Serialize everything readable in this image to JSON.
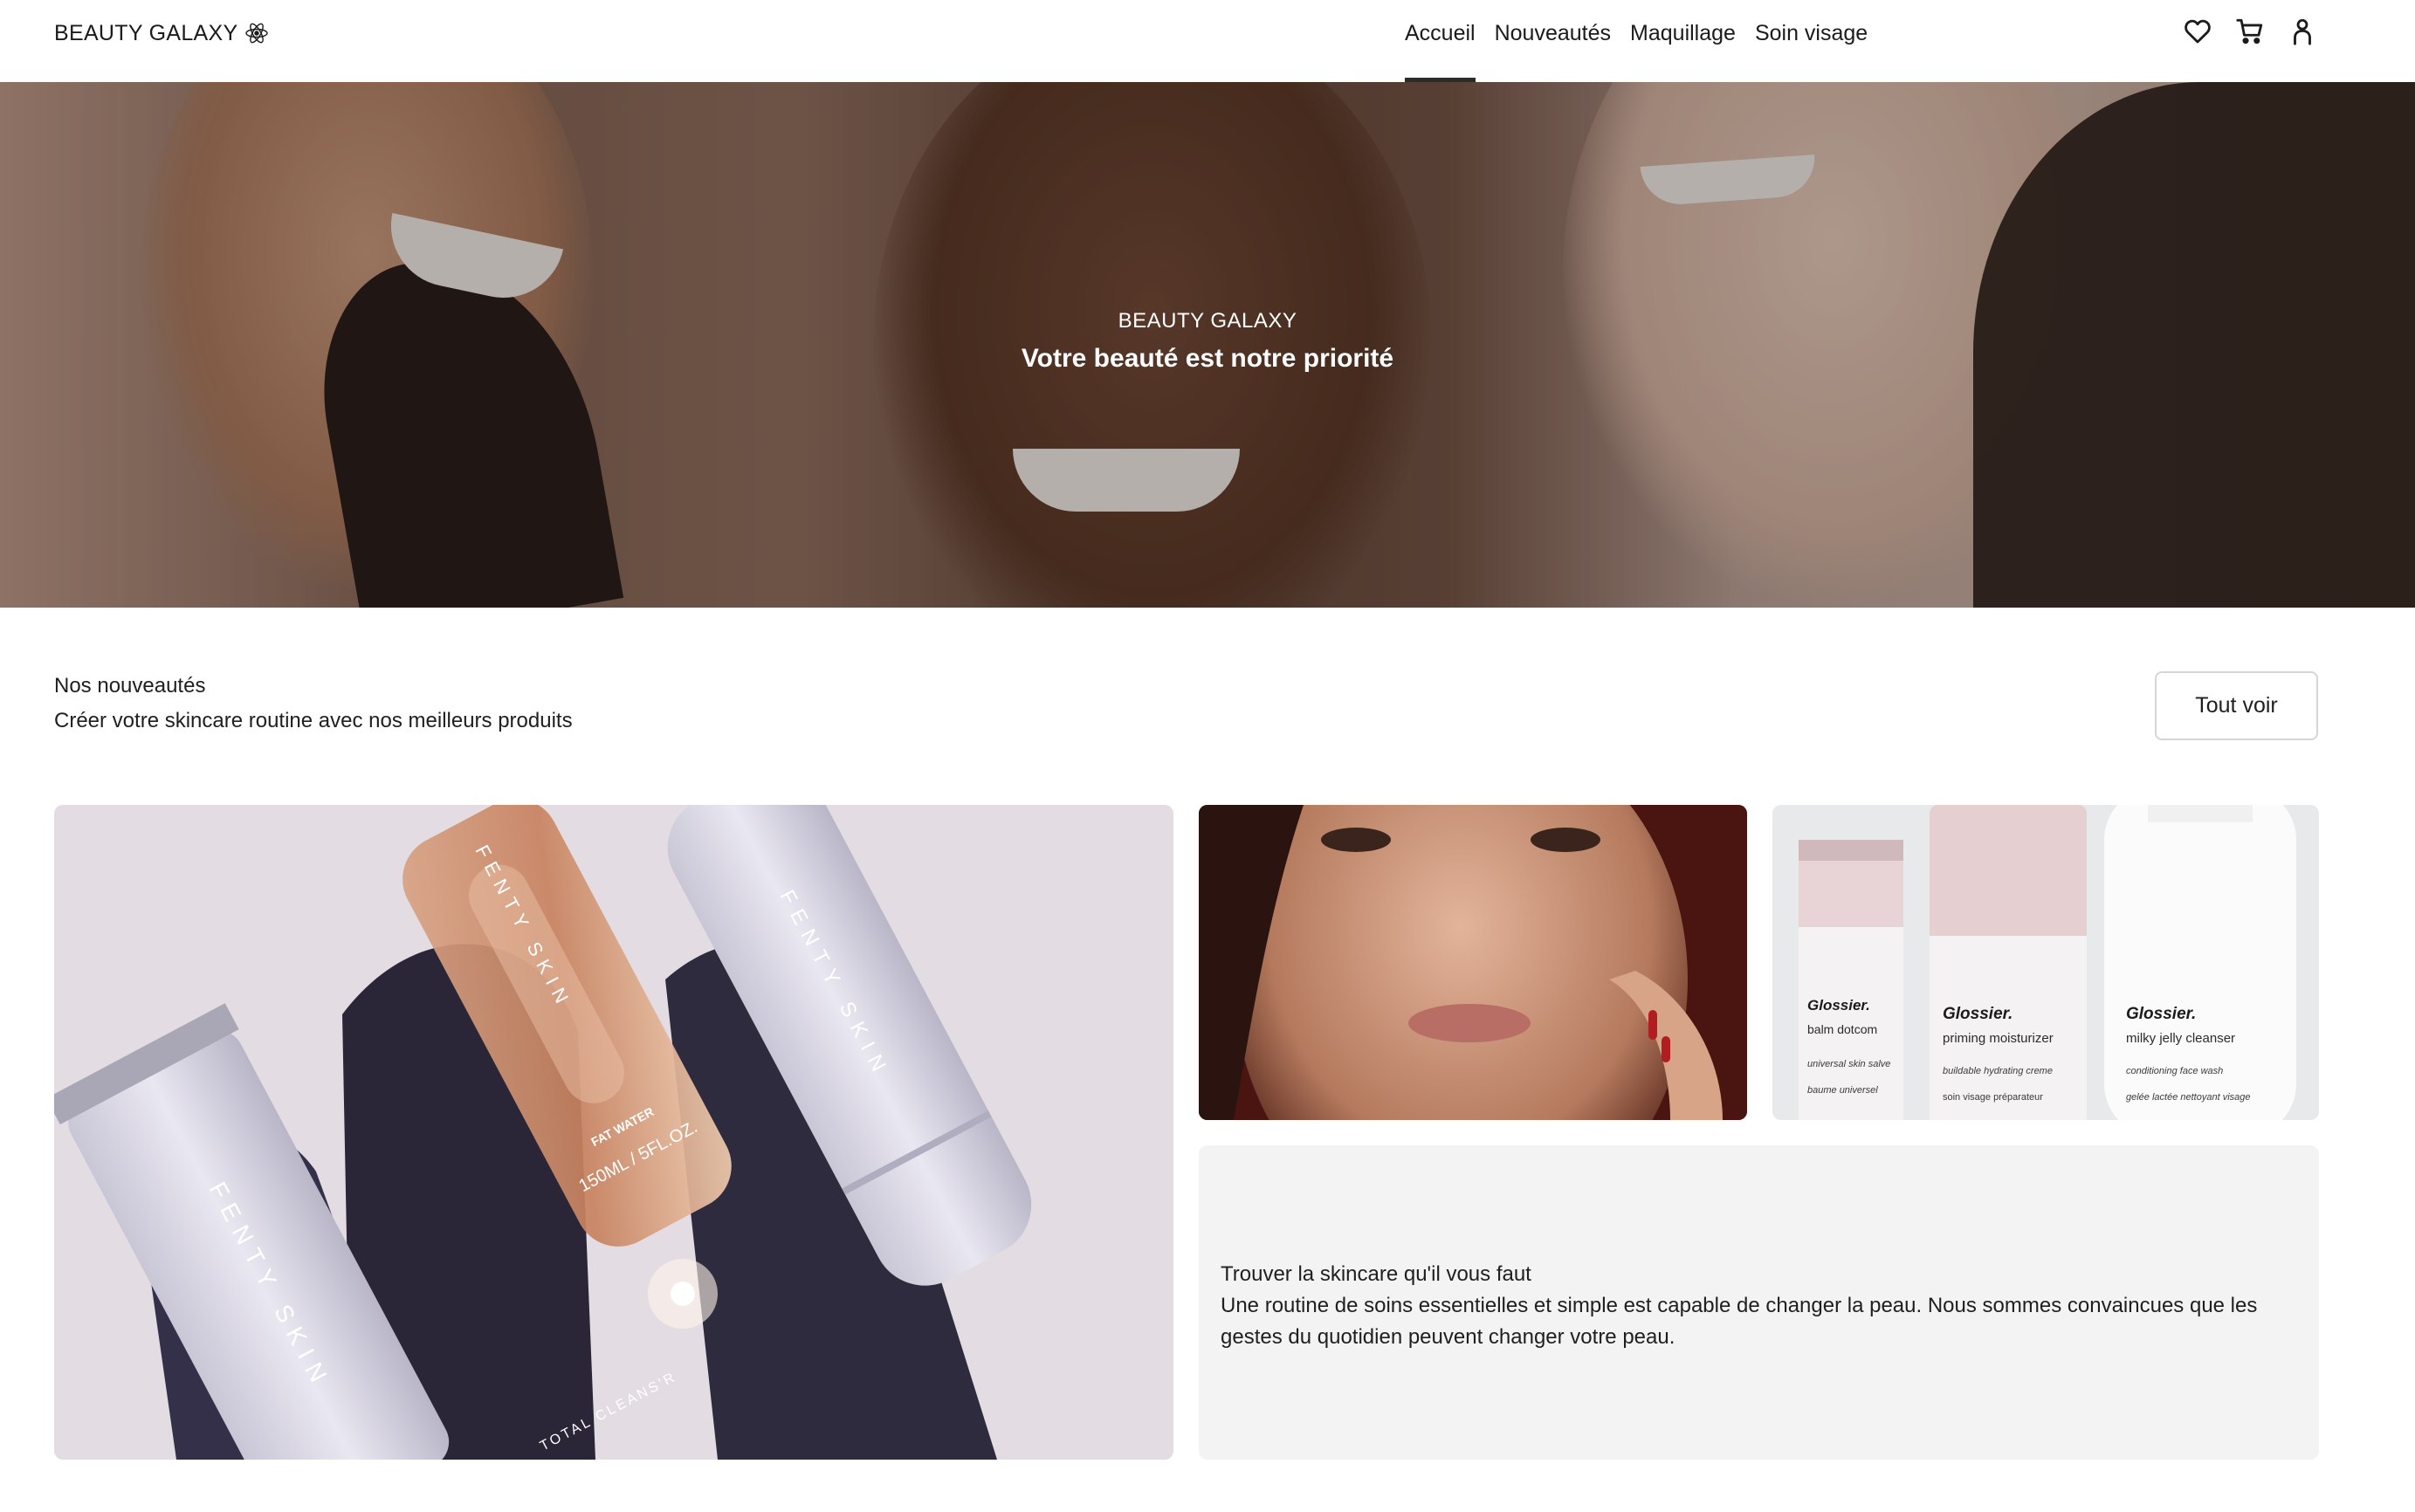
{
  "header": {
    "brand": "BEAUTY GALAXY",
    "nav": [
      {
        "label": "Accueil",
        "active": true
      },
      {
        "label": "Nouveautés",
        "active": false
      },
      {
        "label": "Maquillage",
        "active": false
      },
      {
        "label": "Soin visage",
        "active": false
      }
    ],
    "icons": [
      "heart-icon",
      "cart-icon",
      "user-icon"
    ]
  },
  "hero": {
    "kicker": "BEAUTY GALAXY",
    "title": "Votre beauté est notre priorité"
  },
  "new_products": {
    "title": "Nos nouveautés",
    "subtitle": "Créer votre skincare routine avec nos meilleurs produits",
    "see_all_label": "Tout voir"
  },
  "products": {
    "fenty": {
      "brand_text": "FENTY SKIN",
      "bottle_name": "FAT WATER",
      "bottle_size": "150ML / 5FL.OZ.",
      "tube_text": "TOTAL CLEANS'R"
    },
    "glossier": {
      "brand": "Glossier.",
      "items": [
        {
          "name": "balm dotcom",
          "sub": "universal skin salve",
          "fr": "baume universel"
        },
        {
          "name": "priming moisturizer",
          "sub": "buildable hydrating creme",
          "fr": "soin visage préparateur"
        },
        {
          "name": "milky jelly cleanser",
          "sub": "conditioning face wash",
          "fr": "gelée lactée nettoyant visage"
        }
      ]
    }
  },
  "skincare_card": {
    "headline": "Trouver la skincare qu'il vous faut",
    "body": "Une routine de soins essentielles et simple est capable de changer la peau. Nous sommes convaincues que les gestes du quotidien peuvent changer votre peau."
  },
  "colors": {
    "text": "#1f1f1f",
    "nav_underline": "#2b2b2b",
    "card_text_bg": "#f3f3f3",
    "button_border": "#d6d6d6"
  }
}
